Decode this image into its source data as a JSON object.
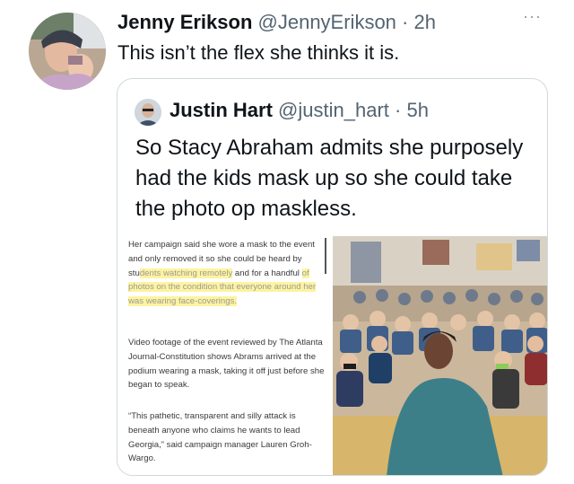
{
  "tweet": {
    "author_name": "Jenny Erikson",
    "handle": "@JennyErikson",
    "time": "· 2h",
    "text": "This isn’t the flex she thinks it is.",
    "more_icon": "···"
  },
  "quoted_tweet": {
    "author_name": "Justin Hart",
    "handle": "@justin_hart",
    "time": "· 5h",
    "text": "So Stacy Abraham admits she purposely had the kids mask up so she could take the photo op maskless."
  },
  "article": {
    "p1_a": "Her campaign said she wore a mask to the event and only removed it so she could be heard by stu",
    "p1_hl1": "dents watching remotely",
    "p1_b": " and for a handful ",
    "p1_hl2": "of photos on the condition that everyone around her was wearing face-coverings.",
    "p2": "Video footage of the event reviewed by The Atlanta Journal-Constitution shows Abrams arrived at the podium wearing a mask, taking it off just before she began to speak.",
    "p3": "“This pathetic, transparent and silly attack is beneath anyone who claims he wants to lead Georgia,” said campaign manager Lauren Groh-Wargo."
  },
  "colors": {
    "highlight": "#fdf3a0",
    "border": "#cfd9de",
    "secondary_text": "#536471"
  }
}
